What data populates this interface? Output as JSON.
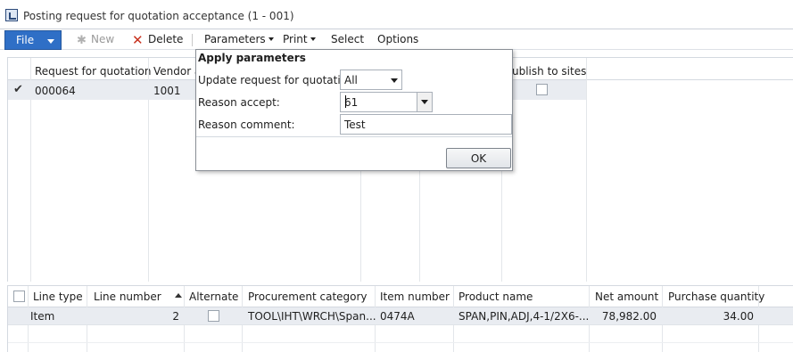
{
  "window": {
    "title": "Posting request for quotation acceptance (1 - 001)"
  },
  "toolbar": {
    "file": "File",
    "new": "New",
    "delete": "Delete",
    "parameters": "Parameters",
    "print": "Print",
    "select": "Select",
    "options": "Options"
  },
  "upper_grid": {
    "columns": [
      "Request for quotation",
      "Vendor a",
      "ublish to sites"
    ],
    "row": {
      "rfq": "000064",
      "vendor": "1001"
    }
  },
  "dialog": {
    "title": "Apply parameters",
    "update_label": "Update request for quotation:",
    "update_value": "All",
    "reason_accept_label": "Reason accept:",
    "reason_accept_value": "61",
    "reason_comment_label": "Reason comment:",
    "reason_comment_value": "Test",
    "ok": "OK"
  },
  "lower_grid": {
    "columns": [
      "Line type",
      "Line number",
      "Alternate",
      "Procurement category",
      "Item number",
      "Product name",
      "Net amount",
      "Purchase quantity"
    ],
    "row": {
      "line_type": "Item",
      "line_number": "2",
      "procurement_category": "TOOL\\IHT\\WRCH\\Span...",
      "item_number": "0474A",
      "product_name": "SPAN,PIN,ADJ,4-1/2X6-...",
      "net_amount": "78,982.00",
      "purchase_quantity": "34.00"
    }
  },
  "icons": {
    "app": "app-icon",
    "new": "new-icon",
    "delete": "delete-icon",
    "row_selected": "checkmark-icon"
  },
  "colors": {
    "file_button": "#2f6fc6",
    "delete_icon": "#c8321e",
    "selected_row": "#e9ecf1"
  }
}
